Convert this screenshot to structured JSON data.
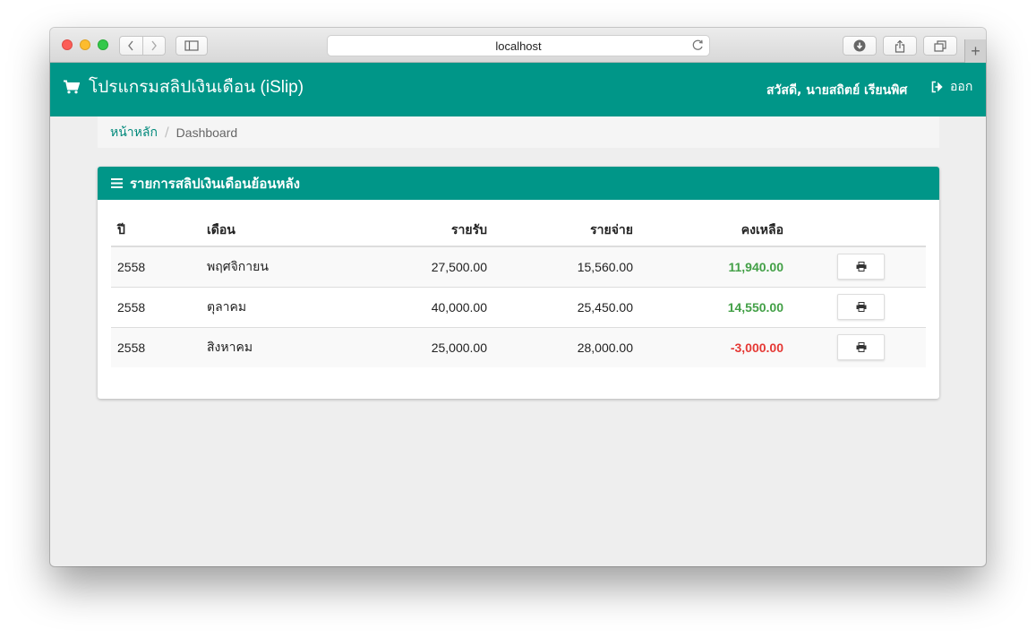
{
  "browser": {
    "url": "localhost",
    "icons": {
      "back": "chevron-left-icon",
      "forward": "chevron-right-icon",
      "sidebar": "sidebar-icon",
      "reload": "reload-icon",
      "download": "download-icon",
      "share": "share-icon",
      "tabs": "tabs-icon",
      "new_tab": "plus-icon"
    },
    "new_tab_label": "+"
  },
  "navbar": {
    "brand": "โปรแกรมสลิปเงินเดือน (iSlip)",
    "brand_icon": "cart-icon",
    "greeting": "สวัสดี, นายสถิตย์ เรียนพิศ",
    "logout_label": "ออก",
    "logout_icon": "sign-out-icon",
    "color": "#009688"
  },
  "breadcrumb": {
    "home": "หน้าหลัก",
    "separator": "/",
    "current": "Dashboard"
  },
  "panel": {
    "title": "รายการสลิปเงินเดือนย้อนหลัง",
    "title_icon": "menu-icon",
    "columns": [
      "ปี",
      "เดือน",
      "รายรับ",
      "รายจ่าย",
      "คงเหลือ",
      ""
    ],
    "rows": [
      {
        "year": "2558",
        "month": "พฤศจิกายน",
        "income": "27,500.00",
        "expense": "15,560.00",
        "balance": "11,940.00",
        "balance_status": "positive"
      },
      {
        "year": "2558",
        "month": "ตุลาคม",
        "income": "40,000.00",
        "expense": "25,450.00",
        "balance": "14,550.00",
        "balance_status": "positive"
      },
      {
        "year": "2558",
        "month": "สิงหาคม",
        "income": "25,000.00",
        "expense": "28,000.00",
        "balance": "-3,000.00",
        "balance_status": "negative"
      }
    ],
    "row_action_icon": "print-icon",
    "colors": {
      "positive": "#43a047",
      "negative": "#e53935"
    }
  }
}
